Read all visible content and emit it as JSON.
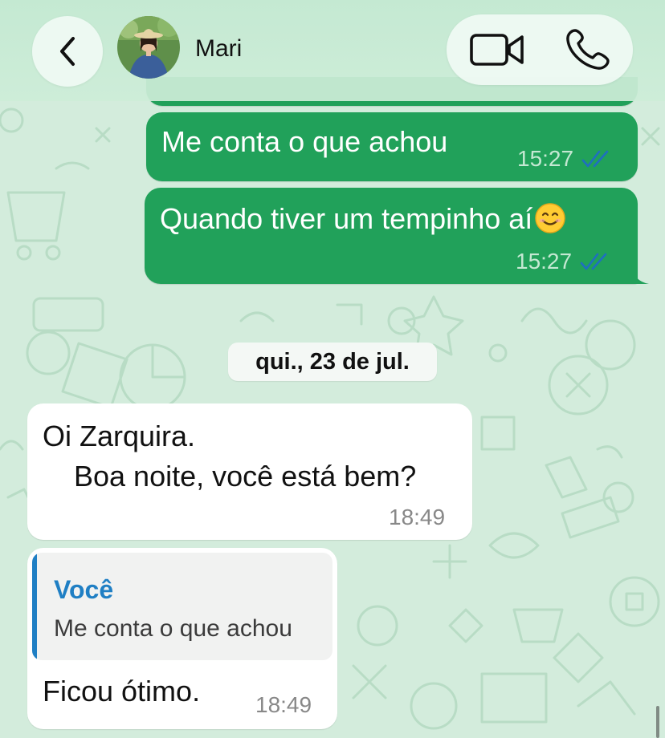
{
  "header": {
    "contact_name": "Mari",
    "icons": {
      "back": "chevron-left-icon",
      "video": "video-camera-icon",
      "phone": "phone-icon"
    }
  },
  "messages": [
    {
      "direction": "outgoing",
      "text": "Me conta o que achou",
      "time": "15:27",
      "status": "read"
    },
    {
      "direction": "outgoing",
      "text": "Quando tiver um tempinho aí",
      "emoji": "smiling-face-icon",
      "time": "15:27",
      "status": "read"
    }
  ],
  "date_separator": "qui., 23 de jul.",
  "incoming": [
    {
      "line1": "Oi Zarquira.",
      "line2": "Boa noite, você está bem?",
      "time": "18:49"
    },
    {
      "quote_author": "Você",
      "quote_text": "Me conta o que achou",
      "text": "Ficou ótimo.",
      "time": "18:49"
    }
  ],
  "colors": {
    "wallpaper": "#d3ecdc",
    "outgoing_bubble": "#21a15a",
    "incoming_bubble": "#ffffff",
    "read_ticks": "#1f6fc0",
    "quote_accent": "#1f7fc4"
  }
}
